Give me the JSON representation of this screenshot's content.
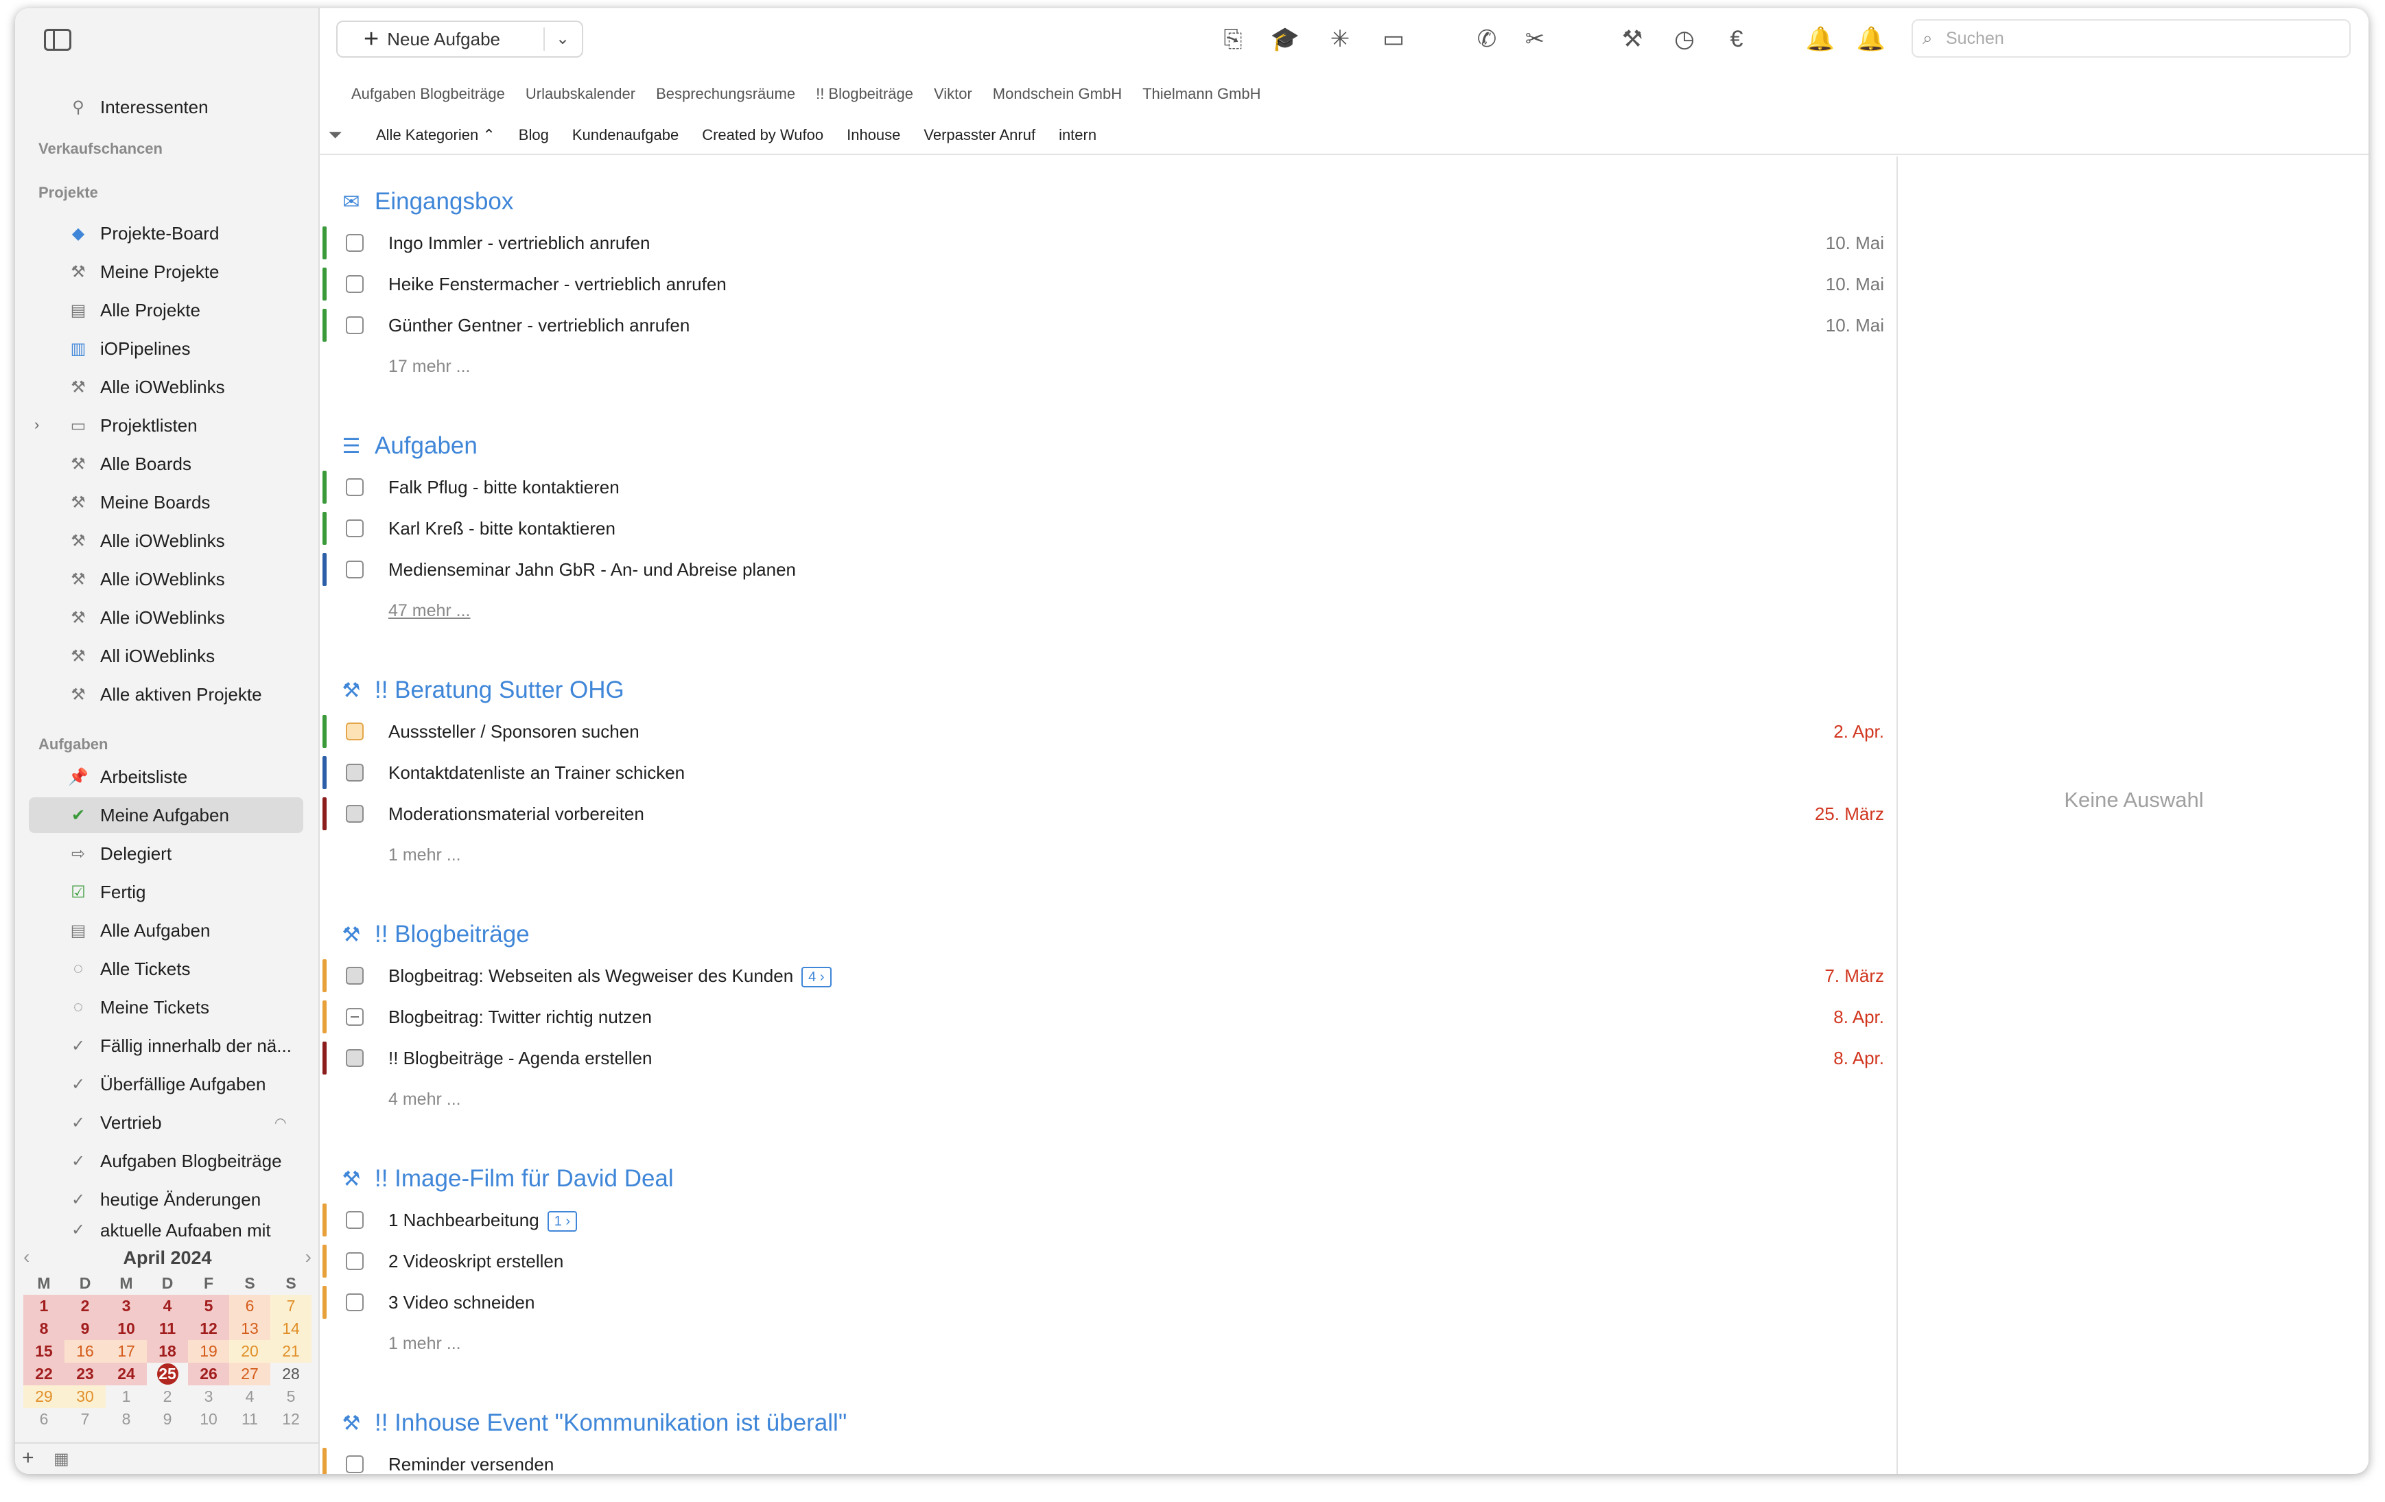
{
  "sidebar": {
    "top_item": "Interessenten",
    "sections": {
      "sales": "Verkaufschancen",
      "projects": "Projekte",
      "tasks": "Aufgaben"
    },
    "project_items": [
      "Projekte-Board",
      "Meine Projekte",
      "Alle Projekte",
      "iOPipelines",
      "Alle iOWeblinks",
      "Projektlisten",
      "Alle Boards",
      "Meine Boards",
      "Alle iOWeblinks",
      "Alle iOWeblinks",
      "Alle iOWeblinks",
      "All iOWeblinks",
      "Alle aktiven Projekte"
    ],
    "task_items": [
      "Arbeitsliste",
      "Meine Aufgaben",
      "Delegiert",
      "Fertig",
      "Alle Aufgaben",
      "Alle Tickets",
      "Meine Tickets",
      "Fällig innerhalb der nä...",
      "Überfällige Aufgaben",
      "Vertrieb",
      "Aufgaben Blogbeiträge",
      "heutige Änderungen",
      "aktuelle Aufgaben mit"
    ],
    "selected": "Meine Aufgaben"
  },
  "calendar": {
    "title": "April 2024",
    "weekdays": [
      "M",
      "D",
      "M",
      "D",
      "F",
      "S",
      "S"
    ],
    "weeks": [
      [
        "1",
        "2",
        "3",
        "4",
        "5",
        "6",
        "7"
      ],
      [
        "8",
        "9",
        "10",
        "11",
        "12",
        "13",
        "14"
      ],
      [
        "15",
        "16",
        "17",
        "18",
        "19",
        "20",
        "21"
      ],
      [
        "22",
        "23",
        "24",
        "25",
        "26",
        "27",
        "28"
      ],
      [
        "29",
        "30",
        "1",
        "2",
        "3",
        "4",
        "5"
      ],
      [
        "6",
        "7",
        "8",
        "9",
        "10",
        "11",
        "12"
      ]
    ],
    "today": "25"
  },
  "toolbar": {
    "new_task": "Neue Aufgabe",
    "search_placeholder": "Suchen"
  },
  "tabs": [
    "Aufgaben Blogbeiträge",
    "Urlaubskalender",
    "Besprechungsräume",
    "!! Blogbeiträge",
    "Viktor",
    "Mondschein GmbH",
    "Thielmann GmbH"
  ],
  "filters": [
    "Alle Kategorien ⌃",
    "Blog",
    "Kundenaufgabe",
    "Created by Wufoo",
    "Inhouse",
    "Verpasster Anruf",
    "intern"
  ],
  "sections": [
    {
      "title": "Eingangsbox",
      "tasks": [
        {
          "title": "Ingo Immler - vertrieblich anrufen",
          "date": "10. Mai"
        },
        {
          "title": "Heike Fenstermacher - vertrieblich anrufen",
          "date": "10. Mai"
        },
        {
          "title": "Günther Gentner - vertrieblich anrufen",
          "date": "10. Mai"
        }
      ],
      "more": "17 mehr ..."
    },
    {
      "title": "Aufgaben",
      "tasks": [
        {
          "title": "Falk Pflug - bitte kontaktieren",
          "date": ""
        },
        {
          "title": "Karl Kreß - bitte kontaktieren",
          "date": ""
        },
        {
          "title": "Medienseminar Jahn GbR - An- und Abreise planen",
          "date": ""
        }
      ],
      "more": "47 mehr ..."
    },
    {
      "title": "!! Beratung Sutter OHG",
      "tasks": [
        {
          "title": "Ausssteller / Sponsoren suchen",
          "date": "2. Apr."
        },
        {
          "title": "Kontaktdatenliste an Trainer schicken",
          "date": ""
        },
        {
          "title": "Moderationsmaterial vorbereiten",
          "date": "25. März"
        }
      ],
      "more": "1 mehr ..."
    },
    {
      "title": "!! Blogbeiträge",
      "tasks": [
        {
          "title": "Blogbeitrag: Webseiten als Wegweiser des Kunden",
          "date": "7. März",
          "badge": "4 ›"
        },
        {
          "title": "Blogbeitrag: Twitter richtig nutzen",
          "date": "8. Apr."
        },
        {
          "title": "!! Blogbeiträge - Agenda erstellen",
          "date": "8. Apr."
        }
      ],
      "more": "4 mehr ..."
    },
    {
      "title": "!! Image-Film für David Deal",
      "tasks": [
        {
          "title": "1 Nachbearbeitung",
          "date": "",
          "badge": "1 ›"
        },
        {
          "title": "2 Videoskript erstellen",
          "date": ""
        },
        {
          "title": "3 Video schneiden",
          "date": ""
        }
      ],
      "more": "1 mehr ..."
    },
    {
      "title": "!! Inhouse Event \"Kommunikation ist überall\"",
      "tasks": [
        {
          "title": "Reminder versenden",
          "date": ""
        }
      ]
    }
  ],
  "detail": {
    "empty": "Keine Auswahl"
  },
  "colors": {
    "accent": "#3f86d8",
    "green": "#3a9a3a",
    "blue": "#2c5fa8",
    "orange": "#e8a03a",
    "darkred": "#8b1d1d",
    "overdue": "#d1361f"
  }
}
